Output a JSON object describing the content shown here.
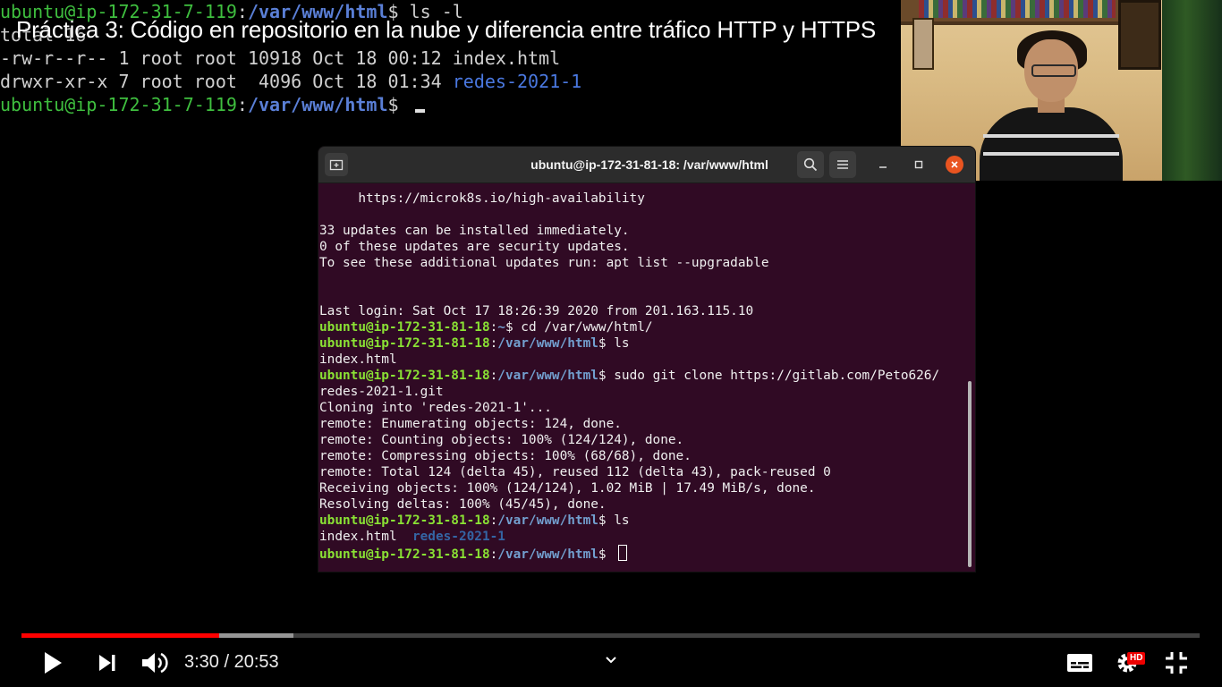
{
  "video": {
    "title": "Práctica 3: Código en repositorio en la nube y diferencia entre tráfico HTTP y HTTPS",
    "time_current": "3:30",
    "time_separator": " / ",
    "time_total": "20:53",
    "progress_fraction": 0.168,
    "buffered_fraction": 0.231,
    "hd_label": "HD"
  },
  "bg_terminal": {
    "lines": [
      {
        "prompt": "ubuntu@ip-172-31-7-119",
        "sep": ":",
        "path": "/var/www/html",
        "cmd": "$ ls -l"
      },
      {
        "text": "total 16"
      },
      {
        "text": "-rw-r--r-- 1 root root 10918 Oct 18 00:12 index.html"
      },
      {
        "text": "drwxr-xr-x 7 root root  4096 Oct 18 01:34 ",
        "dir": "redes-2021-1"
      },
      {
        "prompt": "ubuntu@ip-172-31-7-119",
        "sep": ":",
        "path": "/var/www/html",
        "cmd": "$ "
      }
    ]
  },
  "terminal": {
    "title": "ubuntu@ip-172-31-81-18: /var/www/html",
    "lines": [
      {
        "text": "     https://microk8s.io/high-availability"
      },
      {
        "text": ""
      },
      {
        "text": "33 updates can be installed immediately."
      },
      {
        "text": "0 of these updates are security updates."
      },
      {
        "text": "To see these additional updates run: apt list --upgradable"
      },
      {
        "text": ""
      },
      {
        "text": ""
      },
      {
        "text": "Last login: Sat Oct 17 18:26:39 2020 from 201.163.115.10"
      },
      {
        "prompt": "ubuntu@ip-172-31-81-18",
        "sep": ":",
        "path": "~",
        "cmd": "$ cd /var/www/html/"
      },
      {
        "prompt": "ubuntu@ip-172-31-81-18",
        "sep": ":",
        "path": "/var/www/html",
        "cmd": "$ ls"
      },
      {
        "text": "index.html"
      },
      {
        "prompt": "ubuntu@ip-172-31-81-18",
        "sep": ":",
        "path": "/var/www/html",
        "cmd": "$ sudo git clone https://gitlab.com/Peto626/"
      },
      {
        "text": "redes-2021-1.git"
      },
      {
        "text": "Cloning into 'redes-2021-1'..."
      },
      {
        "text": "remote: Enumerating objects: 124, done."
      },
      {
        "text": "remote: Counting objects: 100% (124/124), done."
      },
      {
        "text": "remote: Compressing objects: 100% (68/68), done."
      },
      {
        "text": "remote: Total 124 (delta 45), reused 112 (delta 43), pack-reused 0"
      },
      {
        "text": "Receiving objects: 100% (124/124), 1.02 MiB | 17.49 MiB/s, done."
      },
      {
        "text": "Resolving deltas: 100% (45/45), done."
      },
      {
        "prompt": "ubuntu@ip-172-31-81-18",
        "sep": ":",
        "path": "/var/www/html",
        "cmd": "$ ls"
      },
      {
        "text": "index.html  ",
        "dir": "redes-2021-1"
      },
      {
        "prompt": "ubuntu@ip-172-31-81-18",
        "sep": ":",
        "path": "/var/www/html",
        "cmd": "$ ",
        "cursor": true
      }
    ]
  },
  "icons": {
    "new_tab": "new-tab-icon",
    "search": "search-icon",
    "menu": "hamburger-menu-icon",
    "minimize": "minimize-icon",
    "maximize": "maximize-icon",
    "close": "close-icon",
    "play": "play-icon",
    "next": "skip-next-icon",
    "volume": "volume-icon",
    "chevron": "chevron-down-icon",
    "subtitles": "subtitles-icon",
    "settings": "gear-icon",
    "fullscreen_exit": "exit-fullscreen-icon"
  },
  "colors": {
    "terminal_bg": "#300a24",
    "prompt_green": "#8ae234",
    "prompt_path": "#729fcf",
    "progress_red": "#ff0000",
    "close_orange": "#e95420"
  }
}
